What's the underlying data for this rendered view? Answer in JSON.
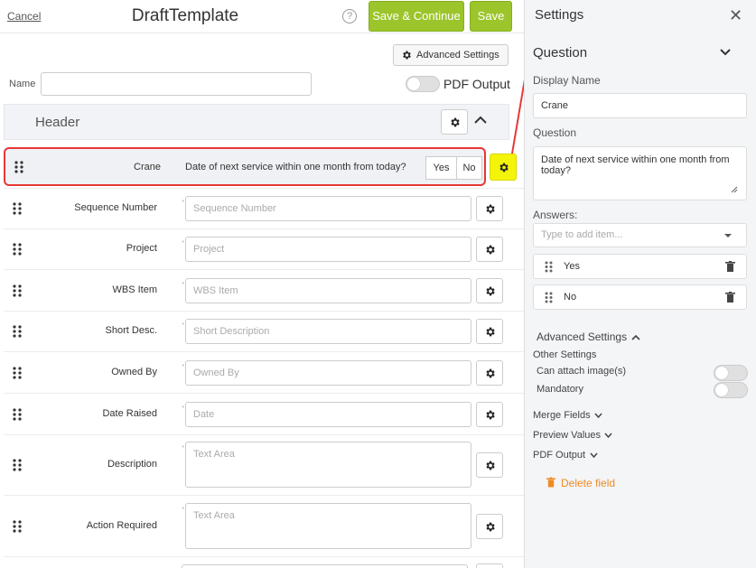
{
  "topbar": {
    "cancel": "Cancel",
    "title": "DraftTemplate",
    "help": "?",
    "save_continue": "Save & Continue",
    "save": "Save"
  },
  "toolbar": {
    "advanced_settings": "Advanced Settings"
  },
  "name_field": {
    "label": "Name",
    "value": ""
  },
  "pdf_output": {
    "label": "PDF Output",
    "enabled": false
  },
  "section": {
    "label": "Header"
  },
  "selected_row": {
    "label": "Crane",
    "question": "Date of next service within one month from today?",
    "answers": [
      "Yes",
      "No"
    ]
  },
  "rows": [
    {
      "label": "Sequence Number",
      "placeholder": "Sequence Number"
    },
    {
      "label": "Project",
      "placeholder": "Project"
    },
    {
      "label": "WBS Item",
      "placeholder": "WBS Item"
    },
    {
      "label": "Short Desc.",
      "placeholder": "Short Description"
    },
    {
      "label": "Owned By",
      "placeholder": "Owned By"
    },
    {
      "label": "Date Raised",
      "placeholder": "Date"
    },
    {
      "label": "Description",
      "placeholder": "Text Area"
    },
    {
      "label": "Action Required",
      "placeholder": "Text Area"
    }
  ],
  "settings": {
    "title": "Settings",
    "section": "Question",
    "display_name_label": "Display Name",
    "display_name_value": "Crane",
    "question_label": "Question",
    "question_value": "Date of next service within one month from today?",
    "answers_label": "Answers:",
    "answers_placeholder": "Type to add item...",
    "answers": [
      "Yes",
      "No"
    ],
    "advanced_label": "Advanced Settings",
    "other_settings_label": "Other Settings",
    "can_attach_label": "Can attach image(s)",
    "mandatory_label": "Mandatory",
    "merge_fields": "Merge Fields",
    "preview_values": "Preview Values",
    "pdf_output": "PDF Output",
    "delete_field": "Delete field"
  },
  "colors": {
    "accent_green": "#9bc52a",
    "highlight_yellow": "#f4f40a",
    "annotation_red": "#e53935",
    "delete_orange": "#f08a24"
  }
}
